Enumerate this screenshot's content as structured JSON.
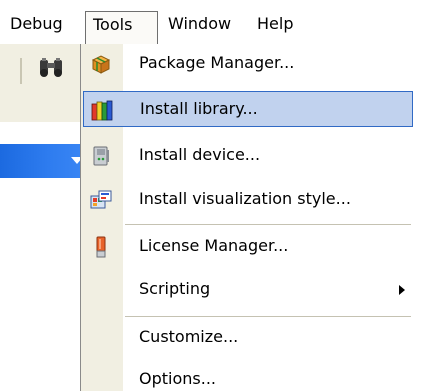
{
  "menubar": {
    "items": [
      {
        "label": "Debug"
      },
      {
        "label": "Tools"
      },
      {
        "label": "Window"
      },
      {
        "label": "Help"
      }
    ]
  },
  "tools_menu": {
    "items": [
      {
        "label": "Package Manager...",
        "icon": "package-icon"
      },
      {
        "label": "Install library...",
        "icon": "library-books-icon",
        "highlighted": true
      },
      {
        "label": "Install device...",
        "icon": "device-icon"
      },
      {
        "label": "Install visualization style...",
        "icon": "visualization-style-icon"
      },
      {
        "label": "License Manager...",
        "icon": "license-icon"
      },
      {
        "label": "Scripting",
        "has_submenu": true
      },
      {
        "label": "Customize..."
      },
      {
        "label": "Options..."
      }
    ]
  },
  "colors": {
    "highlight_fill": "#c1d2ee",
    "highlight_border": "#316ac5",
    "icon_column": "#f1efe2",
    "title_blue": "#2f7df0"
  }
}
